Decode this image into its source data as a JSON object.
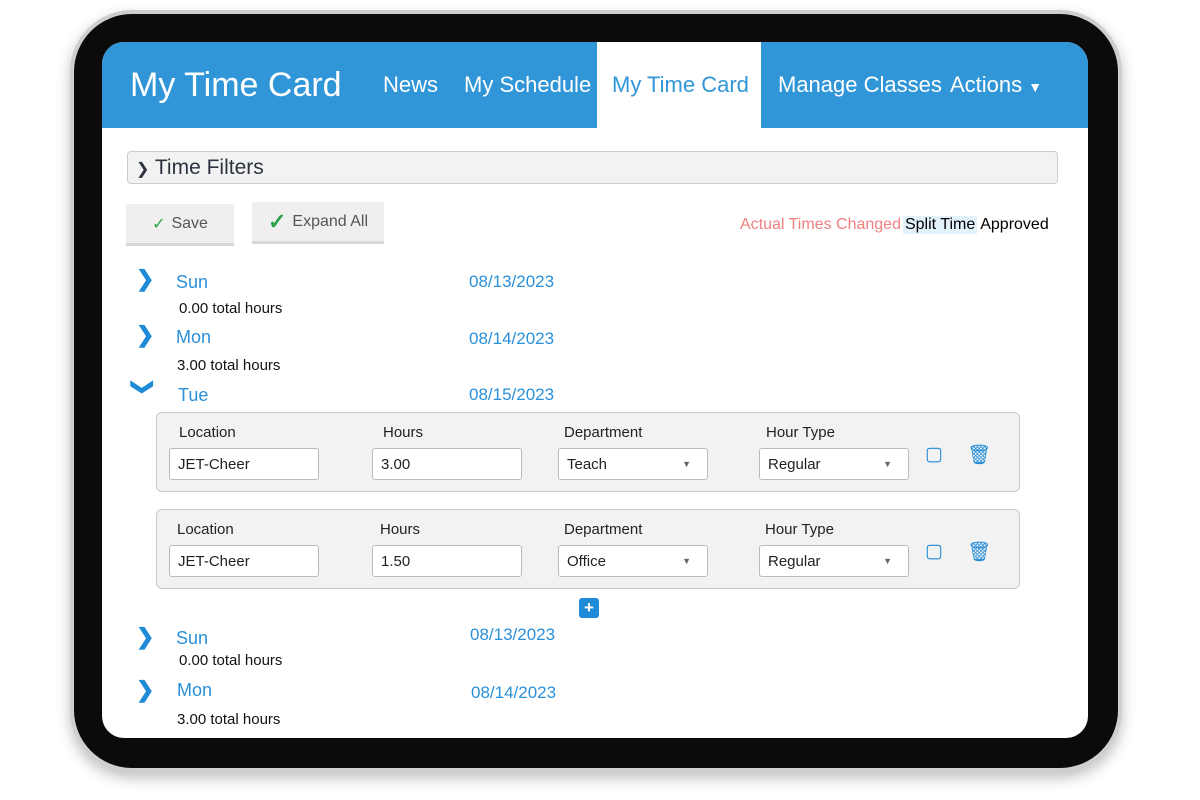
{
  "nav": {
    "brand": "My Time Card",
    "items": [
      "News",
      "My Schedule",
      "My Time Card",
      "Manage Classes",
      "Actions"
    ],
    "active": "My Time Card"
  },
  "filters": {
    "label": "Time Filters"
  },
  "toolbar": {
    "save_label": "Save",
    "expand_label": "Expand All"
  },
  "legend": {
    "changed": "Actual Times Changed",
    "split": "Split Time",
    "approved": "Approved"
  },
  "days": [
    {
      "day": "Sun",
      "date": "08/13/2023",
      "total": "0.00 total hours",
      "expanded": false
    },
    {
      "day": "Mon",
      "date": "08/14/2023",
      "total": "3.00 total hours",
      "expanded": false
    },
    {
      "day": "Tue",
      "date": "08/15/2023",
      "expanded": true,
      "entries": [
        {
          "location": "JET-Cheer",
          "hours": "3.00",
          "department": "Teach",
          "hour_type": "Regular"
        },
        {
          "location": "JET-Cheer",
          "hours": "1.50",
          "department": "Office",
          "hour_type": "Regular"
        }
      ]
    },
    {
      "day": "Sun",
      "date": "08/13/2023",
      "total": "0.00 total hours",
      "expanded": false
    },
    {
      "day": "Mon",
      "date": "08/14/2023",
      "total": "3.00 total hours",
      "expanded": false
    }
  ],
  "labels": {
    "location": "Location",
    "hours": "Hours",
    "department": "Department",
    "hour_type": "Hour Type"
  },
  "colors": {
    "accent": "#3196d8",
    "changed": "#f08080",
    "split_bg": "#e3f1fb"
  }
}
